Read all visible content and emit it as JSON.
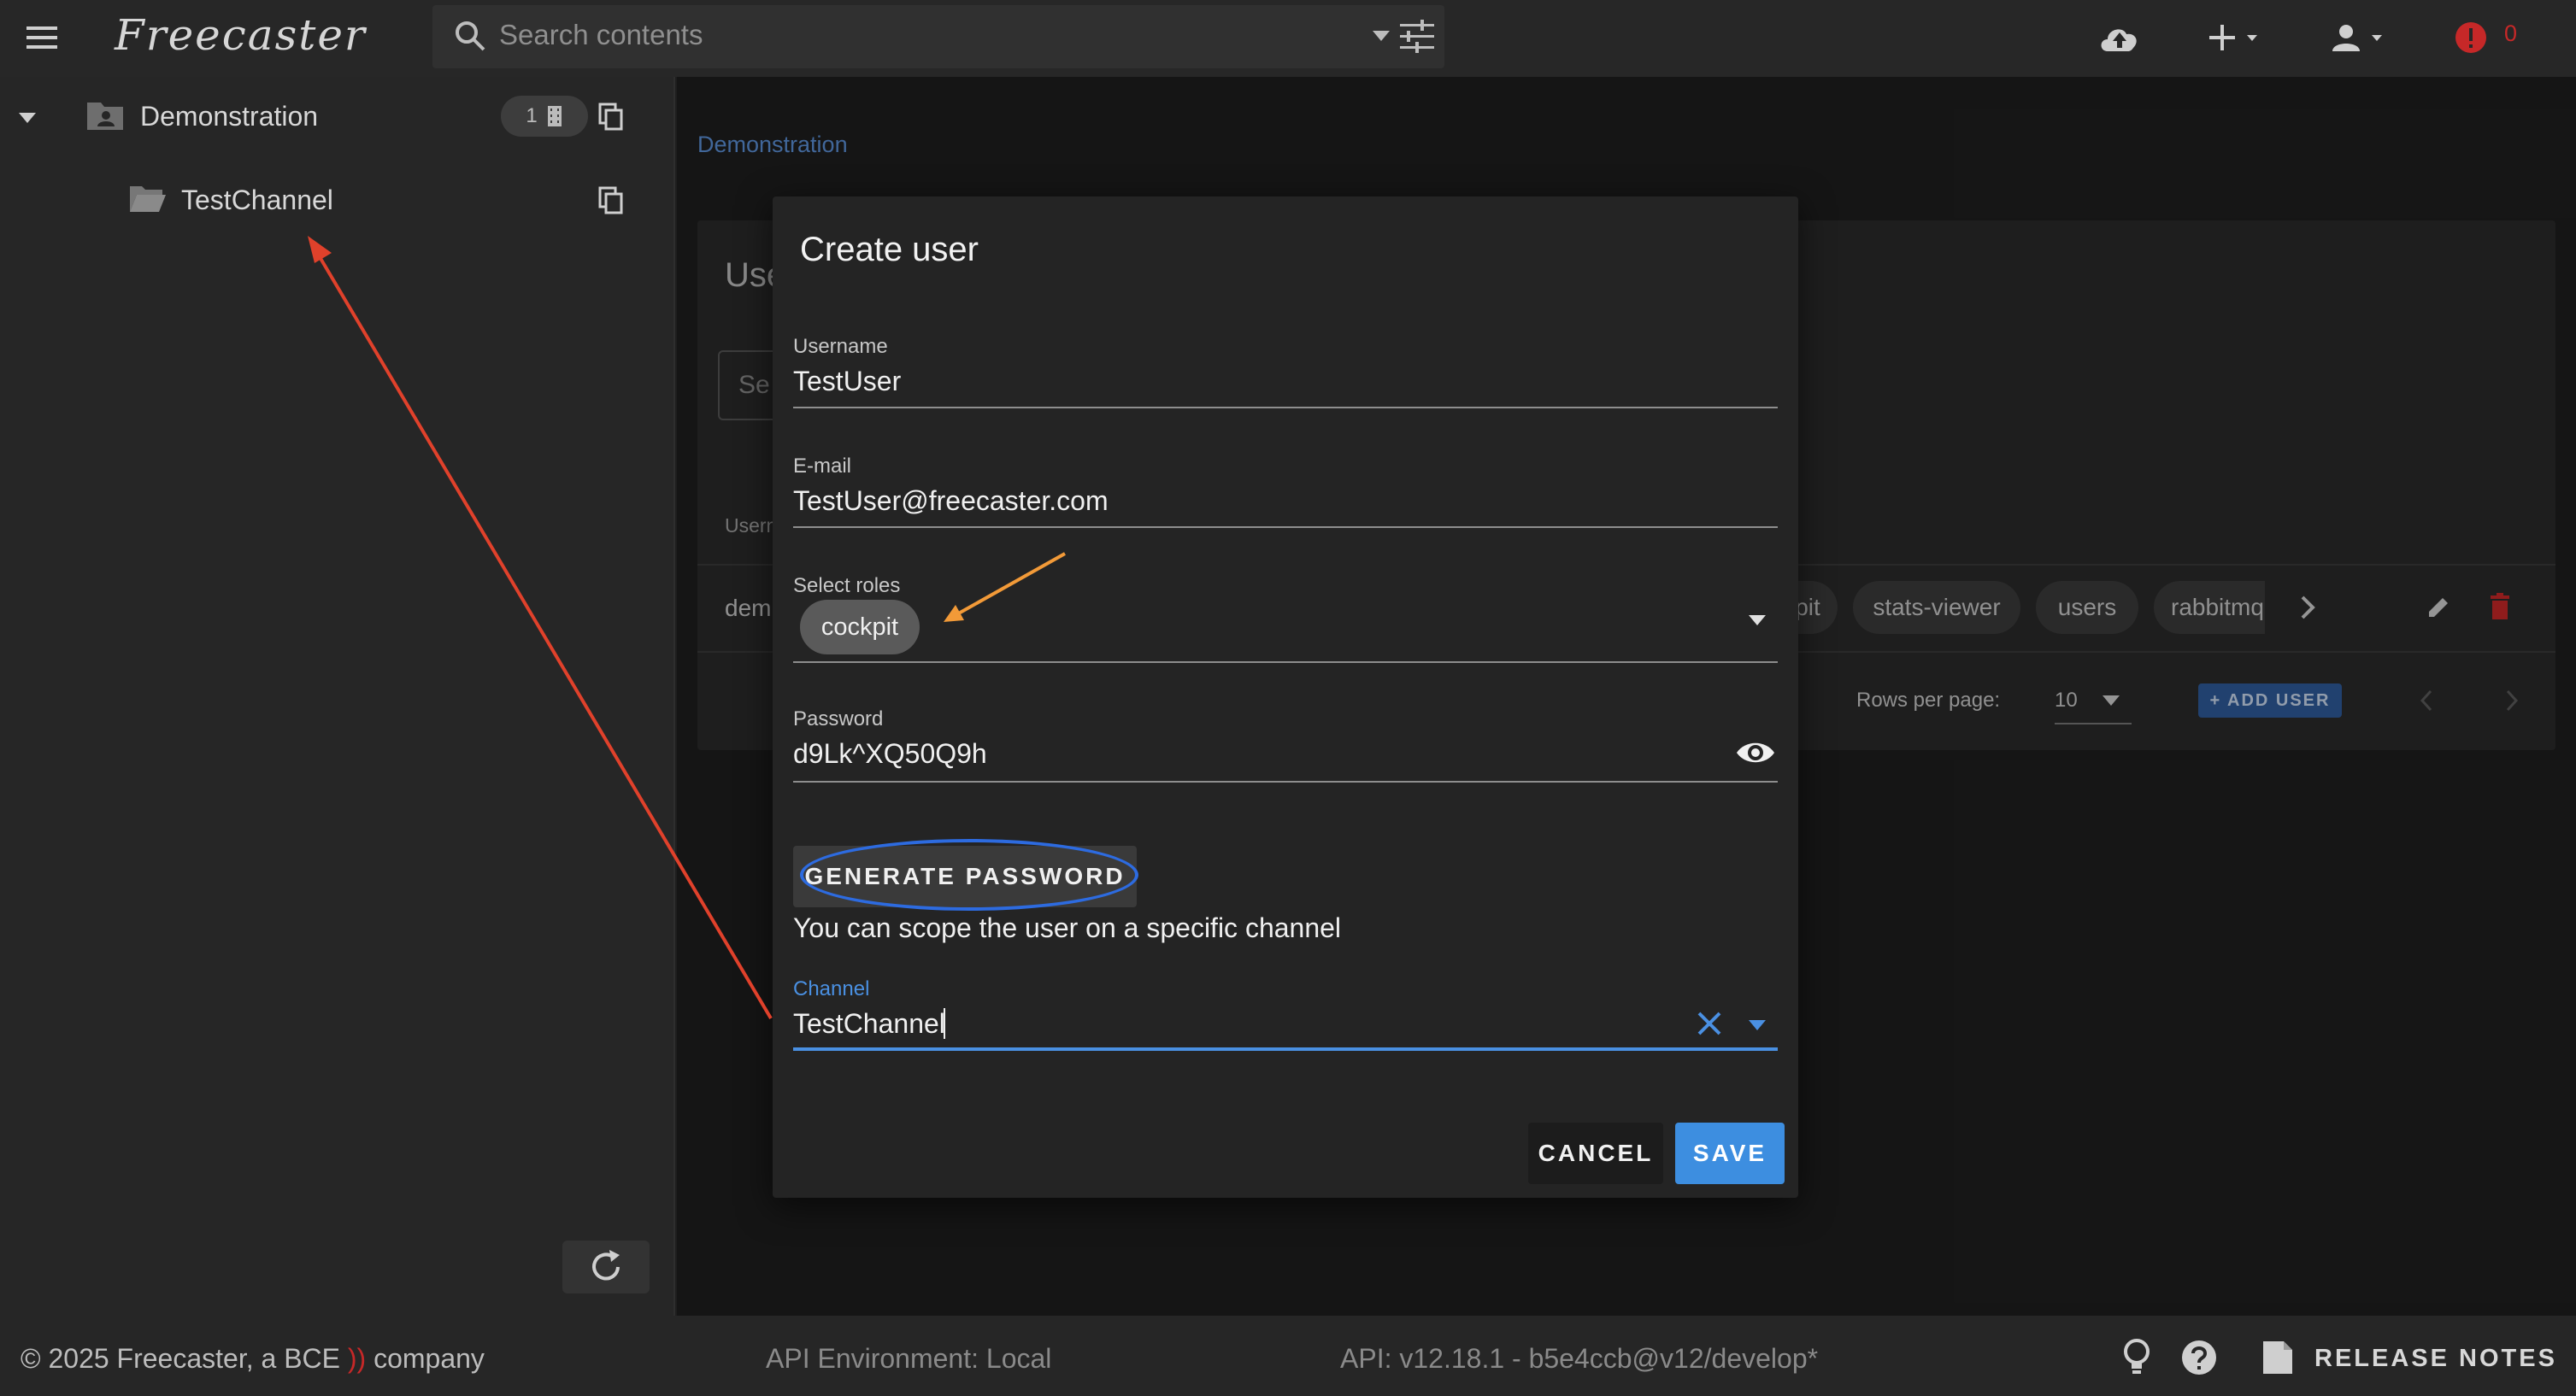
{
  "header": {
    "brand": "Freecaster",
    "search_placeholder": "Search contents",
    "notification_count": "0"
  },
  "sidebar": {
    "root_label": "Demonstration",
    "root_count": "1",
    "child_label": "TestChannel"
  },
  "main": {
    "breadcrumb": "Demonstration",
    "card_title_partial": "Use",
    "search_partial": "Se",
    "column_partial": "Usern",
    "row_partial": "dem",
    "chip_partial": "pit",
    "chips": [
      "stats-viewer",
      "users",
      "rabbitmq"
    ],
    "rows_per_page_label": "Rows per page:",
    "rows_per_page_value": "10",
    "add_user_label": "+ ADD USER"
  },
  "dialog": {
    "title": "Create user",
    "username_label": "Username",
    "username_value": "TestUser",
    "email_label": "E-mail",
    "email_value": "TestUser@freecaster.com",
    "roles_label": "Select roles",
    "selected_role": "cockpit",
    "password_label": "Password",
    "password_value": "d9Lk^XQ50Q9h",
    "generate_label": "GENERATE PASSWORD",
    "scope_text": "You can scope the user on a specific channel",
    "channel_label": "Channel",
    "channel_value": "TestChannel",
    "cancel_label": "CANCEL",
    "save_label": "SAVE"
  },
  "footer": {
    "copyright_pre": "© 2025 Freecaster, a BCE ",
    "copyright_mark": "))",
    "copyright_post": " company",
    "api_env": "API Environment: Local",
    "api_version": "API: v12.18.1 - b5e4ccb@v12/develop*",
    "release_notes": "RELEASE NOTES"
  },
  "colors": {
    "accent": "#3d8ee0",
    "focus": "#4a90e2",
    "danger": "#c62828",
    "annotation_red": "#e0412b",
    "annotation_orange": "#f29a38",
    "annotation_blue": "#2d6be0"
  }
}
